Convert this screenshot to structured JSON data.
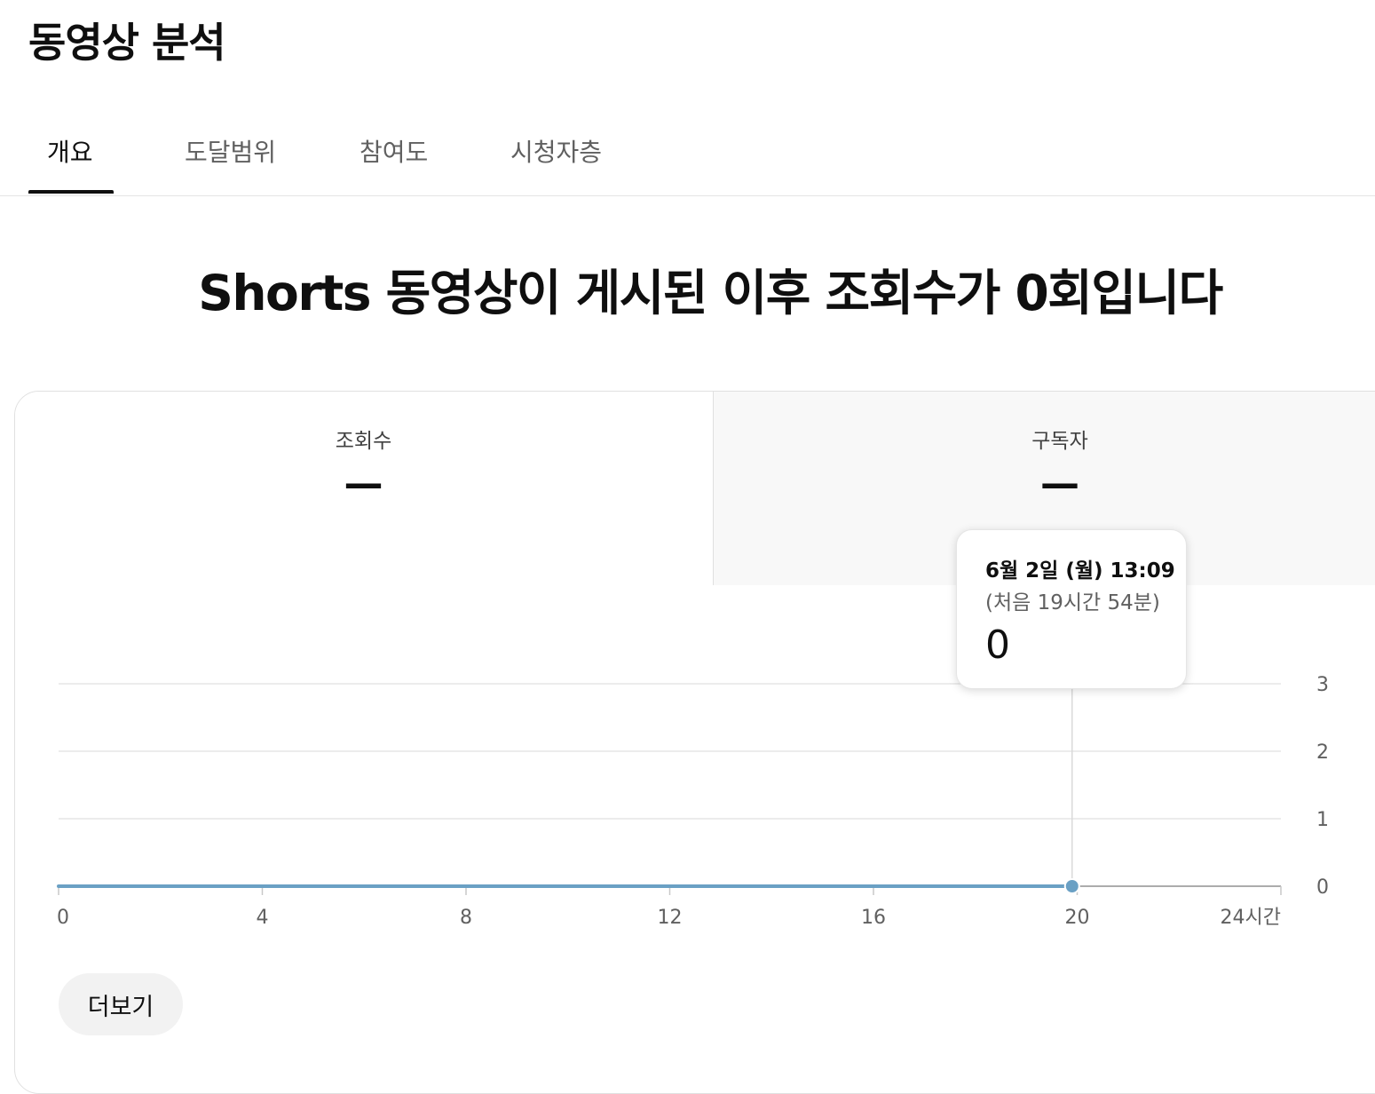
{
  "page": {
    "title": "동영상 분석"
  },
  "tabs": [
    {
      "label": "개요",
      "active": true
    },
    {
      "label": "도달범위",
      "active": false
    },
    {
      "label": "참여도",
      "active": false
    },
    {
      "label": "시청자층",
      "active": false
    }
  ],
  "headline": "Shorts 동영상이 게시된 이후 조회수가 0회입니다",
  "metrics": {
    "views": {
      "label": "조회수",
      "value": "—"
    },
    "subscribers": {
      "label": "구독자",
      "value": "—"
    }
  },
  "tooltip": {
    "date": "6월 2일 (월) 13:09",
    "subtitle": "(처음 19시간 54분)",
    "value": "0"
  },
  "more_button": {
    "label": "더보기"
  },
  "chart_data": {
    "type": "line",
    "x_ticks": [
      "0",
      "4",
      "8",
      "12",
      "16",
      "20",
      "24시간"
    ],
    "y_ticks": [
      "0",
      "1",
      "2",
      "3"
    ],
    "xlim": [
      0,
      24
    ],
    "ylim": [
      0,
      3
    ],
    "series": [
      {
        "x": [
          0,
          19.9
        ],
        "y": [
          0,
          0
        ]
      }
    ],
    "highlight_point": {
      "x": 19.9,
      "y": 0
    },
    "grid": true,
    "y_axis_side": "right",
    "colors": {
      "line": "#6aa0c4",
      "grid": "#e5e5e5",
      "axis": "#909090"
    }
  }
}
